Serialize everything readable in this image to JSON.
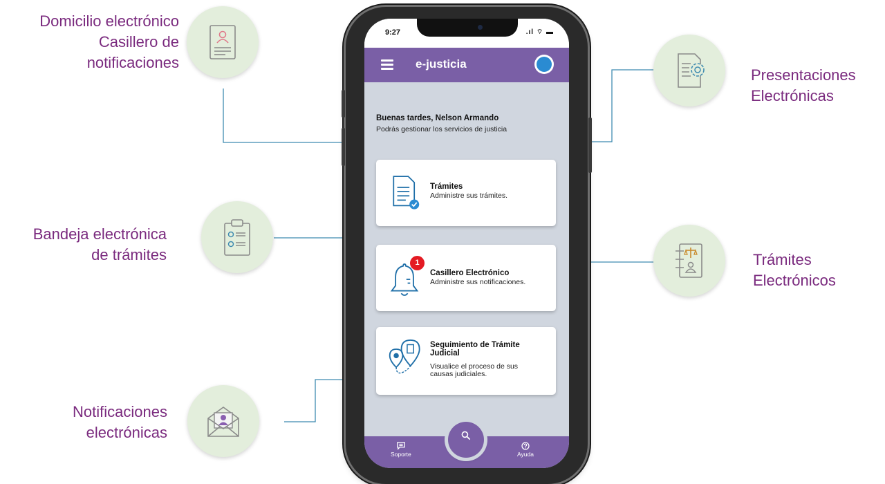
{
  "features": {
    "domicilio": {
      "line1": "Domicilio electrónico",
      "line2": "Casillero de",
      "line3": "notificaciones",
      "icon": "profile-document-icon"
    },
    "bandeja": {
      "line1": "Bandeja electrónica",
      "line2": "de trámites",
      "icon": "clipboard-checklist-icon"
    },
    "notificaciones": {
      "line1": "Notificaciones",
      "line2": "electrónicas",
      "icon": "envelope-user-icon"
    },
    "presentaciones": {
      "line1": "Presentaciones",
      "line2": "Electrónicas",
      "icon": "document-gear-icon"
    },
    "tramites_electronicos": {
      "line1": "Trámites",
      "line2": "Electrónicos",
      "icon": "justice-scale-document-icon"
    }
  },
  "phone": {
    "status": {
      "time": "9:27",
      "icons": ".ıl ⌔ ▬"
    },
    "app": {
      "title": "e-justicia",
      "menu_icon": "hamburger-menu-icon",
      "avatar_icon": "user-avatar-icon"
    },
    "greeting": {
      "title": "Buenas tardes, Nelson Armando",
      "subtitle": "Podrás gestionar los servicios de justicia"
    },
    "cards": {
      "tramites": {
        "title": "Trámites",
        "subtitle": "Administre sus trámites.",
        "icon": "document-check-icon"
      },
      "casillero": {
        "title": "Casillero Electrónico",
        "subtitle": "Administre sus notificaciones.",
        "badge": "1",
        "icon": "bell-icon"
      },
      "seguimiento": {
        "title_line1": "Seguimiento de Trámite",
        "title_line2": "Judicial",
        "subtitle_line1": "Visualice el proceso de sus",
        "subtitle_line2": "causas judiciales.",
        "icon": "location-pin-route-icon"
      }
    },
    "bottom_nav": {
      "soporte": {
        "label": "Soporte",
        "icon": "chat-icon"
      },
      "ayuda": {
        "label": "Ayuda",
        "icon": "help-circle-icon"
      },
      "search": {
        "icon": "search-icon"
      }
    }
  },
  "colors": {
    "label_purple": "#7a2a7e",
    "app_purple": "#7a5fa6",
    "circle_green": "#e3eedc",
    "connector": "#3f8bb0",
    "badge_red": "#e41b23"
  }
}
